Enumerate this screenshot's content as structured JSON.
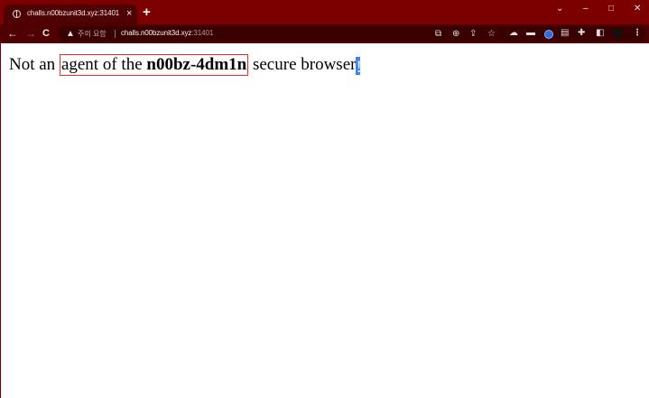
{
  "tab": {
    "title": "challs.n00bzunit3d.xyz:31401",
    "close": "×",
    "new_tab": "+"
  },
  "window": {
    "dropdown": "⌄",
    "minimize": "–",
    "maximize": "□",
    "close": "✕"
  },
  "toolbar": {
    "back": "←",
    "forward": "→",
    "reload": "C",
    "security_warning": "주의 요함",
    "url_host": "challs.n00bzunit3d.xyz",
    "url_port": ":31401"
  },
  "page": {
    "text_before": "Not an ",
    "highlighted_prefix": "agent of the ",
    "highlighted_bold": "n00bz-4dm1n",
    "text_after": " secure browser",
    "selection_char": "!"
  },
  "colors": {
    "frame": "#7d0000",
    "toolbar": "#4f0000",
    "highlight_border": "#e0302d",
    "selection": "#3b82f6"
  }
}
